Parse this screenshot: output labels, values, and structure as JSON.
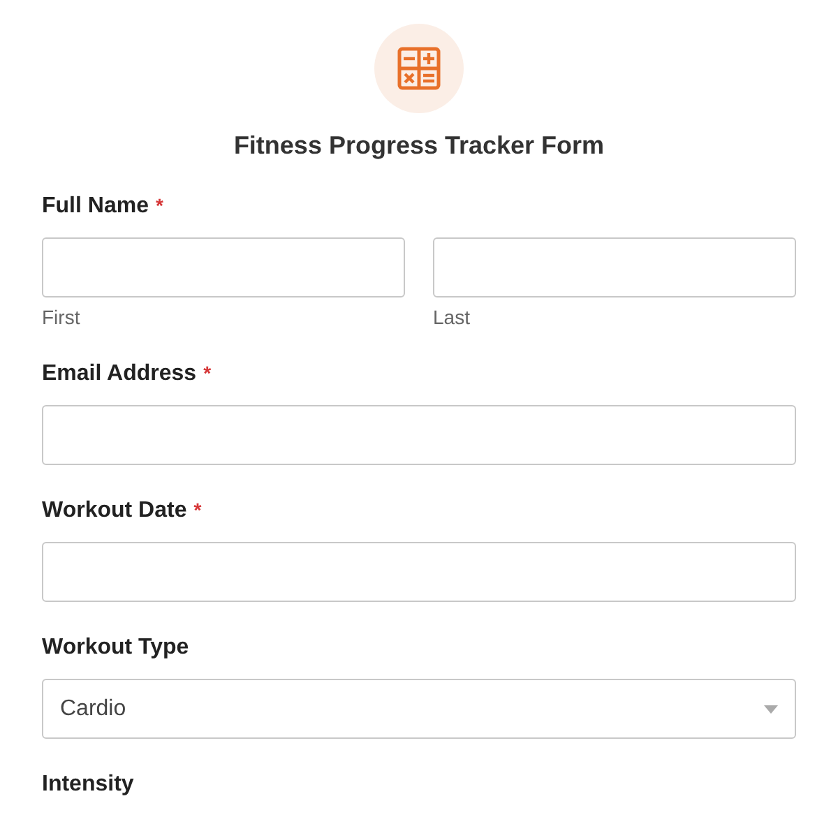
{
  "form": {
    "title": "Fitness Progress Tracker Form"
  },
  "fields": [
    {
      "kind": "name",
      "label": "Full Name",
      "asterisk": "*",
      "parts": [
        {
          "sublabel": "First"
        },
        {
          "sublabel": "Last"
        }
      ]
    },
    {
      "kind": "text",
      "label": "Email Address",
      "asterisk": "*"
    },
    {
      "kind": "text",
      "label": "Workout Date",
      "asterisk": "*"
    },
    {
      "kind": "select",
      "label": "Workout Type",
      "value": "Cardio"
    },
    {
      "kind": "label",
      "label": "Intensity"
    }
  ]
}
